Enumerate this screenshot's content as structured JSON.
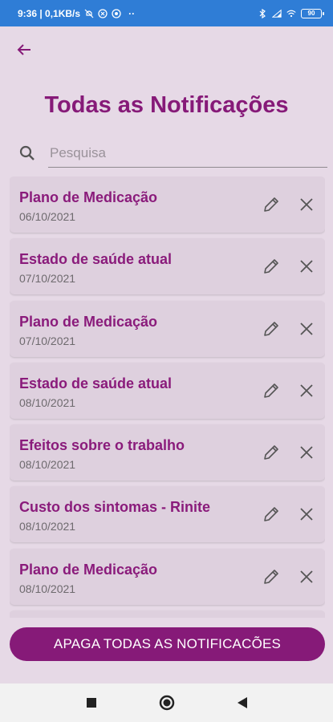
{
  "status_bar": {
    "time_info": "9:36 | 0,1KB/s",
    "more": "··",
    "battery": "90"
  },
  "icons": {
    "back": "arrow-left-icon",
    "search": "search-icon",
    "edit": "pencil-icon",
    "delete": "close-icon"
  },
  "header": {
    "title": "Todas as Notificações"
  },
  "search": {
    "placeholder": "Pesquisa",
    "value": ""
  },
  "notifications": [
    {
      "title": "Plano de Medicação",
      "date": "06/10/2021"
    },
    {
      "title": "Estado de saúde atual",
      "date": "07/10/2021"
    },
    {
      "title": "Plano de Medicação",
      "date": "07/10/2021"
    },
    {
      "title": "Estado de saúde atual",
      "date": "08/10/2021"
    },
    {
      "title": "Efeitos sobre o trabalho",
      "date": "08/10/2021"
    },
    {
      "title": "Custo dos sintomas - Rinite",
      "date": "08/10/2021"
    },
    {
      "title": "Plano de Medicação",
      "date": "08/10/2021"
    },
    {
      "title": "",
      "date": ""
    }
  ],
  "footer": {
    "delete_all_label": "APAGA TODAS AS NOTIFICACÕES"
  },
  "colors": {
    "accent": "#861a78",
    "background": "#e6d9e6",
    "card": "#ded0de",
    "status_bar": "#2f7dd6"
  }
}
